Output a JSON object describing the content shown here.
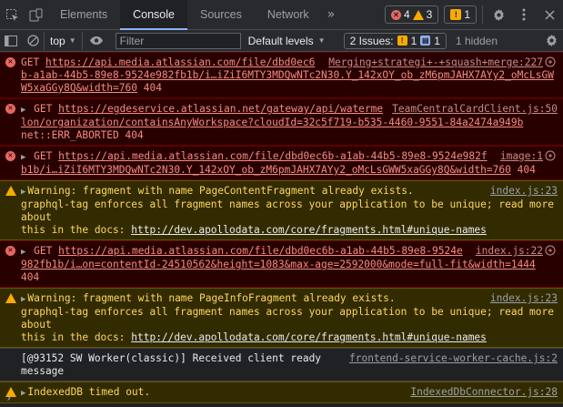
{
  "tabs": {
    "items": [
      "Elements",
      "Console",
      "Sources",
      "Network"
    ],
    "active": "Console",
    "more": "»"
  },
  "toolbar": {
    "error_count": "4",
    "warning_count": "3",
    "info_count": "1"
  },
  "filterbar": {
    "context": "top",
    "filter_placeholder": "Filter",
    "levels": "Default levels",
    "issues_label": "2 Issues:",
    "issues_warn": "1",
    "issues_info": "1",
    "hidden": "1 hidden"
  },
  "messages": [
    {
      "level": "error",
      "prefix": "GET",
      "url": "https://api.media.atlassian.com/file/dbd0ec6b-a1ab-44b5-89e8-9524e982fb1b/i…iZiI6MTY3MDQwNTc2N30.Y_142xOY_ob_zM6pmJAHX7AYy2_oMcLsGWW5xaGGy8Q&width=760",
      "status": "404",
      "source": "Merging+strategi+-+squash+merge:227"
    },
    {
      "level": "error",
      "prefix": "GET",
      "url": "https://egdeservice.atlassian.net/gateway/api/watermelon/organization/containsAnyWorkspace?cloudId=32c5f719-b535-4460-9551-84a2474a949b",
      "status": "net::ERR_ABORTED 404",
      "source": "TeamCentralCardClient.js:50"
    },
    {
      "level": "error",
      "prefix": "GET",
      "url": "https://api.media.atlassian.com/file/dbd0ec6b-a1ab-44b5-89e8-9524e982fb1b/i…iZiI6MTY3MDQwNTc2N30.Y_142xOY_ob_zM6pmJAHX7AYy2_oMcLsGWW5xaGGy8Q&width=760",
      "status": "404",
      "source": "image:1"
    },
    {
      "level": "warning",
      "text1": "Warning: fragment with name PageContentFragment already exists.",
      "text2": "graphql-tag enforces all fragment names across your application to be unique; read more about",
      "text3": "this in the docs: ",
      "link": "http://dev.apollodata.com/core/fragments.html#unique-names",
      "source": "index.js:23"
    },
    {
      "level": "error",
      "prefix": "GET",
      "url": "https://api.media.atlassian.com/file/dbd0ec6b-a1ab-44b5-89e8-9524e982fb1b/i…on=contentId-24510562&height=1083&max-age=2592000&mode=full-fit&width=1444",
      "status": "404",
      "source": "index.js:22"
    },
    {
      "level": "warning",
      "text1": "Warning: fragment with name PageInfoFragment already exists.",
      "text2": "graphql-tag enforces all fragment names across your application to be unique; read more about",
      "text3": "this in the docs: ",
      "link": "http://dev.apollodata.com/core/fragments.html#unique-names",
      "source": "index.js:23"
    },
    {
      "level": "info",
      "text": "[@93152 SW Worker(classic)] Received client ready message",
      "source": "frontend-service-worker-cache.js:2"
    },
    {
      "level": "warning",
      "text1": "IndexedDB timed out.",
      "source": "IndexedDbConnector.js:28"
    }
  ],
  "colors": {
    "error_bg": "#290000",
    "warning_bg": "#332b00",
    "accent": "#8ab4f8"
  }
}
